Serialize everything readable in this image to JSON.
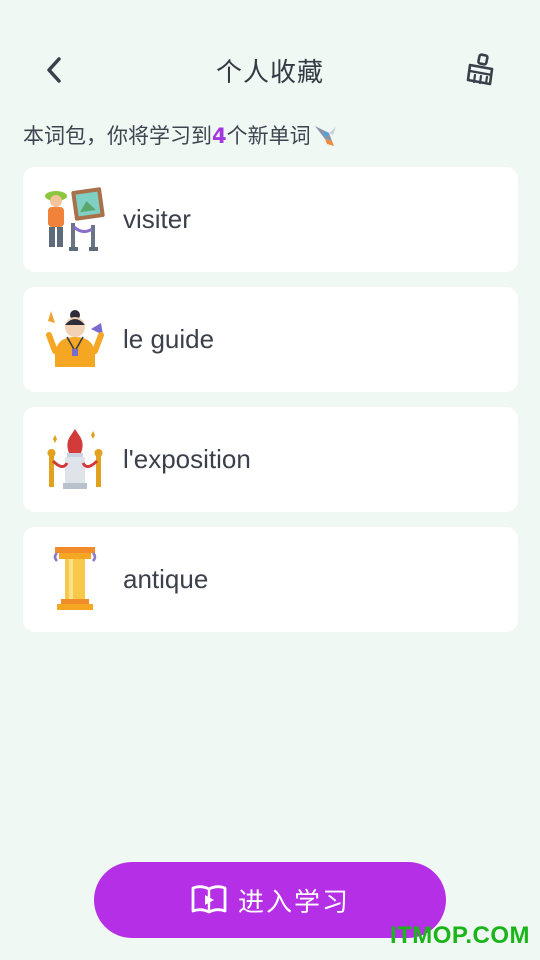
{
  "header": {
    "title": "个人收藏"
  },
  "intro": {
    "prefix": "本词包，你将学习到",
    "count": "4",
    "suffix": "个新单词"
  },
  "words": [
    {
      "word": "visiter"
    },
    {
      "word": "le guide"
    },
    {
      "word": "l'exposition"
    },
    {
      "word": "antique"
    }
  ],
  "cta": {
    "label": "进入学习"
  },
  "watermark": "ITMOP.COM",
  "colors": {
    "background": "#eff8f3",
    "accent": "#b52fe6",
    "count": "#a436e0",
    "card": "#ffffff"
  },
  "icons": {
    "back": "chevron-left-icon",
    "clean": "broom-icon",
    "rocket": "rocket-icon",
    "book": "book-play-icon"
  }
}
